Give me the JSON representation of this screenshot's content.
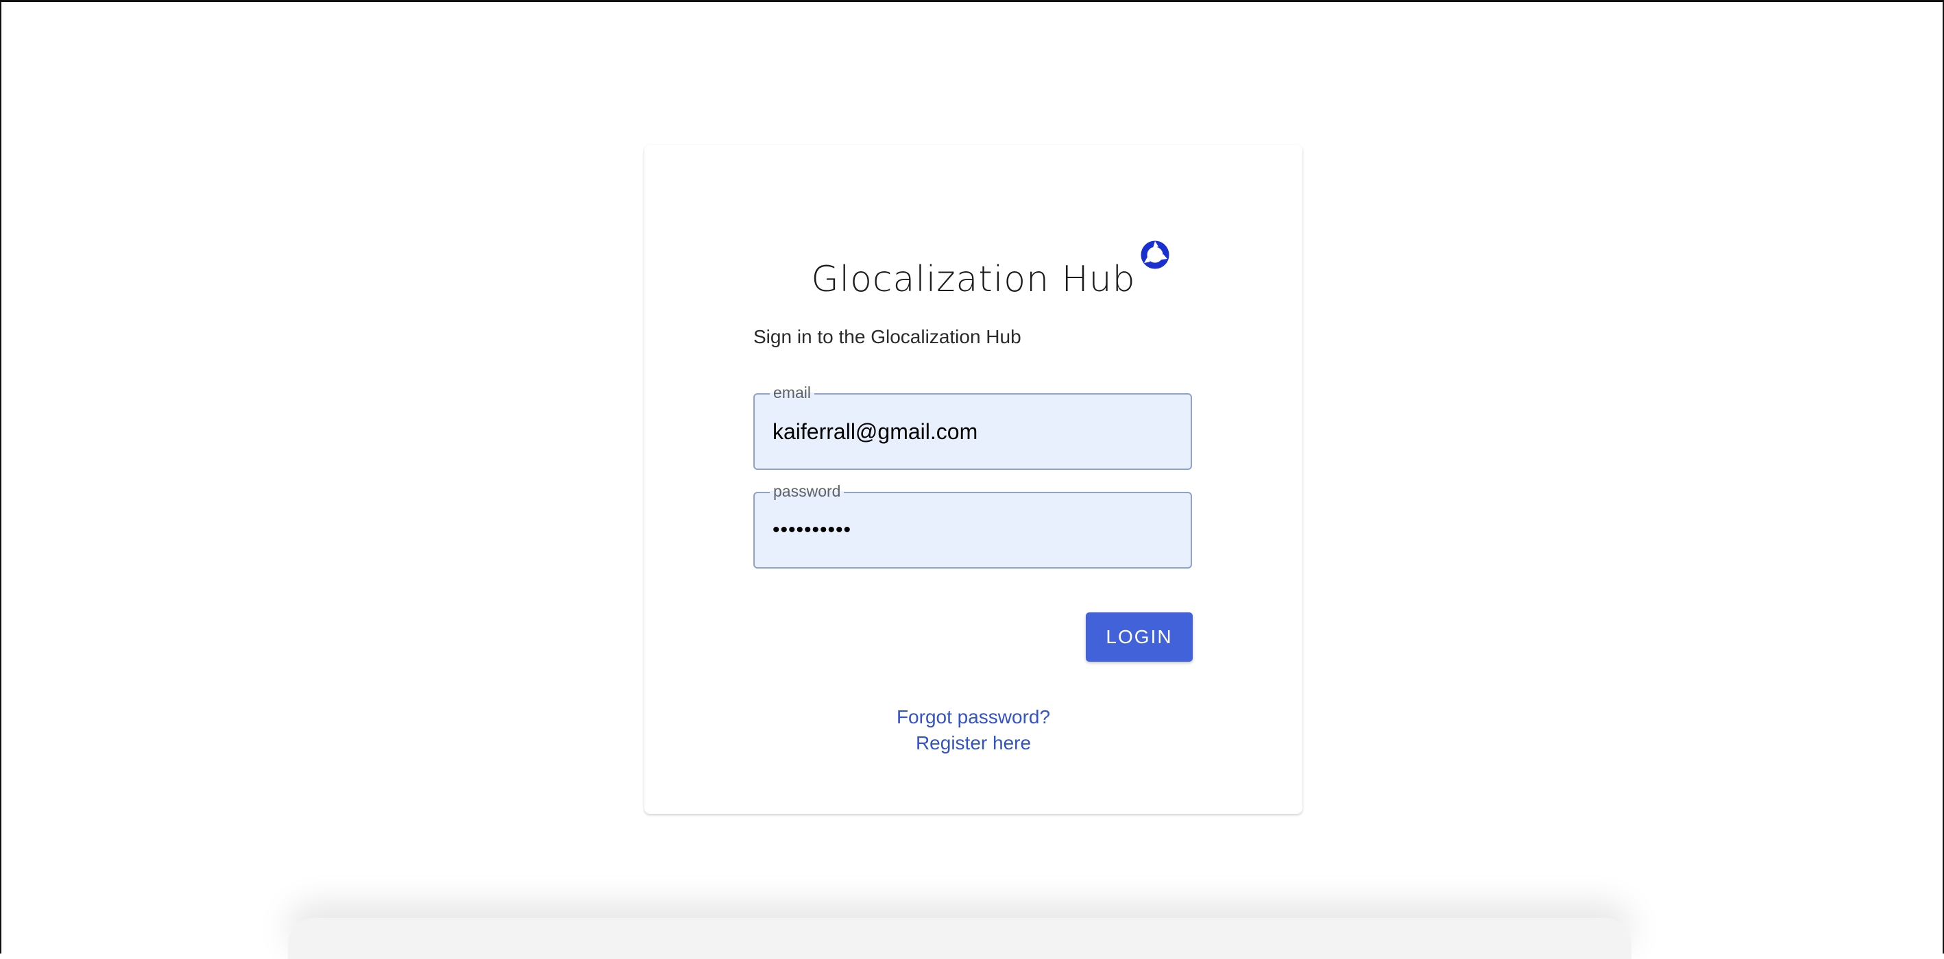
{
  "brand": {
    "title": "Glocalization Hub",
    "logo_icon": "ring-logo-icon",
    "accent_color": "#1a2fd1"
  },
  "login": {
    "subtitle": "Sign in to the Glocalization Hub",
    "email": {
      "label": "email",
      "value": "kaiferrall@gmail.com"
    },
    "password": {
      "label": "password",
      "value": "••••••••••"
    },
    "login_button_label": "LOGIN",
    "button_color": "#4262d9",
    "links": {
      "forgot_password": "Forgot password?",
      "register": "Register here"
    },
    "link_color": "#3354c9"
  }
}
